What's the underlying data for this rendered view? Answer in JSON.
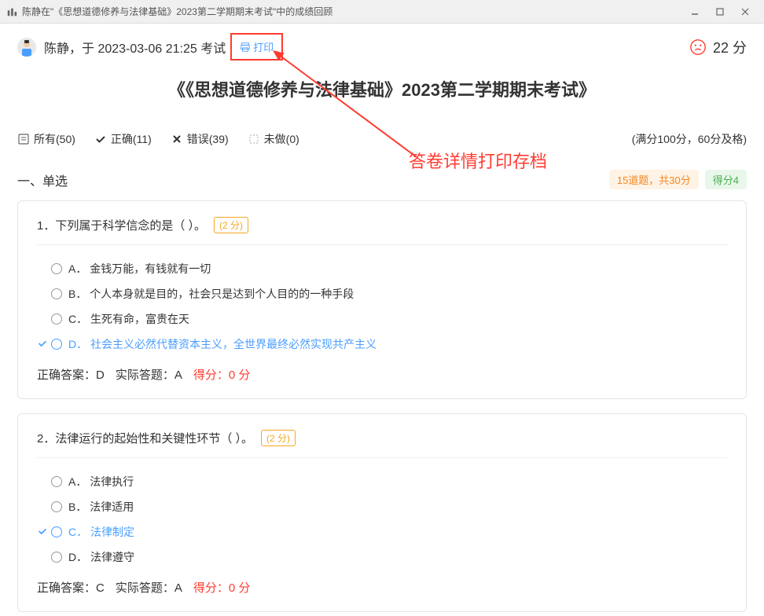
{
  "titlebar": {
    "text": "陈静在\"《思想道德修养与法律基础》2023第二学期期末考试\"中的成绩回顾"
  },
  "header": {
    "user_info": "陈静，于 2023-03-06 21:25 考试",
    "print_label": "打印",
    "score": "22 分"
  },
  "exam_title": "《《思想道德修养与法律基础》2023第二学期期末考试》",
  "filters": {
    "all": "所有(50)",
    "correct": "正确(11)",
    "wrong": "错误(39)",
    "undone": "未做(0)"
  },
  "full_score": "(满分100分，60分及格)",
  "section": {
    "title": "一、单选",
    "badge1": "15道题，共30分",
    "badge2": "得分4"
  },
  "annotation": "答卷详情打印存档",
  "questions": [
    {
      "number": "1．",
      "text": "下列属于科学信念的是（ ）。",
      "points": "(2 分)",
      "options": [
        {
          "letter": "A．",
          "text": "金钱万能，有钱就有一切",
          "selected": false
        },
        {
          "letter": "B．",
          "text": "个人本身就是目的，社会只是达到个人目的的一种手段",
          "selected": false
        },
        {
          "letter": "C．",
          "text": "生死有命，富贵在天",
          "selected": false
        },
        {
          "letter": "D．",
          "text": "社会主义必然代替资本主义，全世界最终必然实现共产主义",
          "selected": true
        }
      ],
      "correct": "D",
      "actual": "A",
      "score": "0 分"
    },
    {
      "number": "2．",
      "text": "法律运行的起始性和关键性环节（ ）。",
      "points": "(2 分)",
      "options": [
        {
          "letter": "A．",
          "text": "法律执行",
          "selected": false
        },
        {
          "letter": "B．",
          "text": "法律适用",
          "selected": false
        },
        {
          "letter": "C．",
          "text": "法律制定",
          "selected": true
        },
        {
          "letter": "D．",
          "text": "法律遵守",
          "selected": false
        }
      ],
      "correct": "C",
      "actual": "A",
      "score": "0 分"
    }
  ],
  "labels": {
    "correct_answer": "正确答案：",
    "actual_answer": "实际答题：",
    "score_label": "得分："
  }
}
